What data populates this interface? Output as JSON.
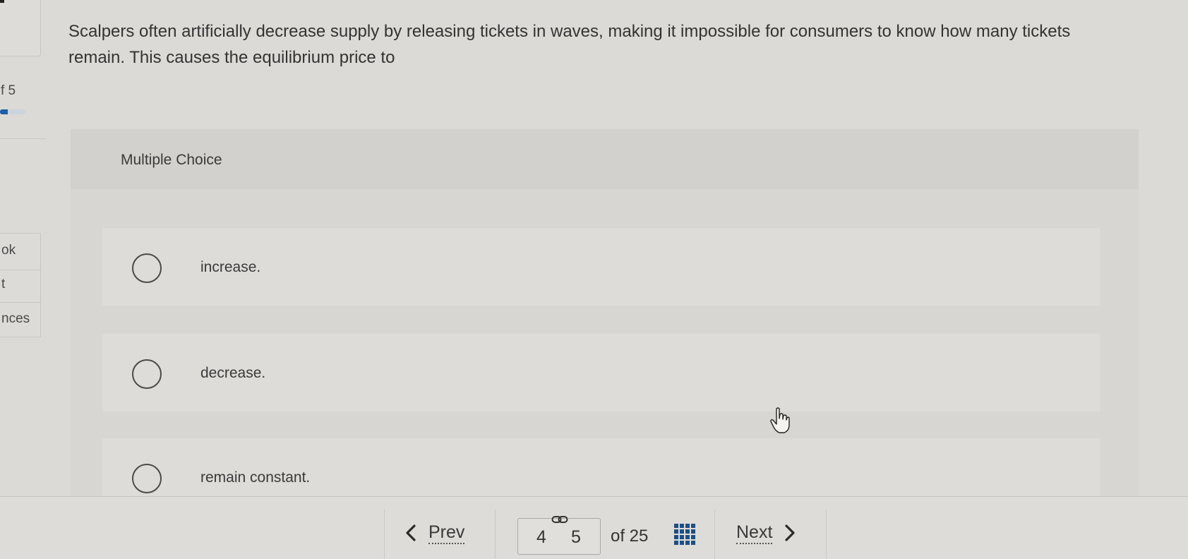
{
  "sidebar": {
    "progress_text": "f 5",
    "progress_fraction": 0.3,
    "items": [
      {
        "label": "ok"
      },
      {
        "label": "t"
      },
      {
        "label": "nces"
      }
    ]
  },
  "question": {
    "text": "Scalpers often artificially decrease supply by releasing tickets in waves, making it impossible for consumers to know how many tickets remain. This causes the equilibrium price to"
  },
  "multiple_choice": {
    "title": "Multiple Choice",
    "options": [
      {
        "label": "increase."
      },
      {
        "label": "decrease."
      },
      {
        "label": "remain constant."
      }
    ]
  },
  "navigation": {
    "prev_label": "Prev",
    "next_label": "Next",
    "page_prev_number": "4",
    "page_current_number": "5",
    "of_text": "of 25"
  },
  "icons": {
    "prev": "chevron-left-icon",
    "next": "chevron-right-icon",
    "link": "link-icon",
    "grid": "grid-icon",
    "cursor": "hand-pointer-icon"
  },
  "colors": {
    "accent": "#1d4f86",
    "progress": "#1d5fa6"
  }
}
